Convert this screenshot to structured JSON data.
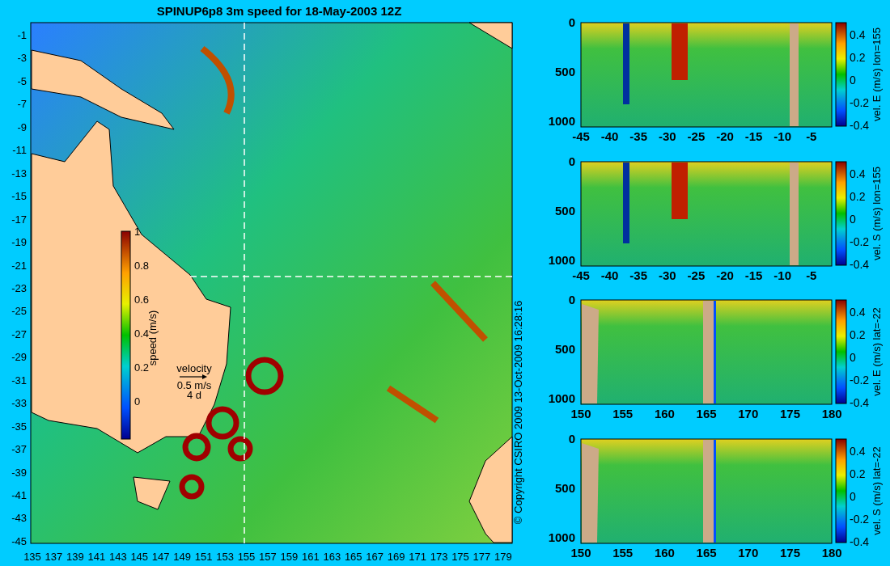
{
  "title": "SPINUP6p8 3m speed for 18-May-2003 12Z",
  "map": {
    "y_tick_labels": [
      "-1",
      "-3",
      "-5",
      "-7",
      "-9",
      "-11",
      "-13",
      "-15",
      "-17",
      "-19",
      "-21",
      "-23",
      "-25",
      "-27",
      "-29",
      "-31",
      "-33",
      "-35",
      "-37",
      "-39",
      "-41",
      "-43",
      "-45"
    ],
    "x_tick_labels": [
      "135",
      "137",
      "139",
      "141",
      "143",
      "145",
      "147",
      "149",
      "151",
      "153",
      "155",
      "157",
      "159",
      "161",
      "163",
      "165",
      "167",
      "169",
      "171",
      "173",
      "175",
      "177",
      "179"
    ],
    "colorbar": {
      "label": "speed (m/s)",
      "tick_labels": [
        "1",
        "0.8",
        "0.6",
        "0.4",
        "0.2",
        "0"
      ]
    },
    "velocity_key": {
      "label": "velocity",
      "speed": "0.5 m/s",
      "duration": "4 d"
    }
  },
  "copyright": "© Copyright CSIRO 2009   13-Oct-2009 16:28:16",
  "sections": [
    {
      "kind": "lon",
      "y_tick_labels": [
        "0",
        "500",
        "1000"
      ],
      "x_tick_labels": [
        "-45",
        "-40",
        "-35",
        "-30",
        "-25",
        "-20",
        "-15",
        "-10",
        "-5"
      ],
      "colorbar": {
        "label": "vel. E (m/s) lon=155",
        "tick_labels": [
          "0.4",
          "0.2",
          "0",
          "-0.2",
          "-0.4"
        ]
      }
    },
    {
      "kind": "lon",
      "y_tick_labels": [
        "0",
        "500",
        "1000"
      ],
      "x_tick_labels": [
        "-45",
        "-40",
        "-35",
        "-30",
        "-25",
        "-20",
        "-15",
        "-10",
        "-5"
      ],
      "colorbar": {
        "label": "vel. S (m/s) lon=155",
        "tick_labels": [
          "0.4",
          "0.2",
          "0",
          "-0.2",
          "-0.4"
        ]
      }
    },
    {
      "kind": "lat",
      "y_tick_labels": [
        "0",
        "500",
        "1000"
      ],
      "x_tick_labels": [
        "150",
        "155",
        "160",
        "165",
        "170",
        "175",
        "180"
      ],
      "colorbar": {
        "label": "vel. E (m/s) lat=-22",
        "tick_labels": [
          "0.4",
          "0.2",
          "0",
          "-0.2",
          "-0.4"
        ]
      }
    },
    {
      "kind": "lat",
      "y_tick_labels": [
        "0",
        "500",
        "1000"
      ],
      "x_tick_labels": [
        "150",
        "155",
        "160",
        "165",
        "170",
        "175",
        "180"
      ],
      "colorbar": {
        "label": "vel. S (m/s) lat=-22",
        "tick_labels": [
          "0.4",
          "0.2",
          "0",
          "-0.2",
          "-0.4"
        ]
      }
    }
  ]
}
